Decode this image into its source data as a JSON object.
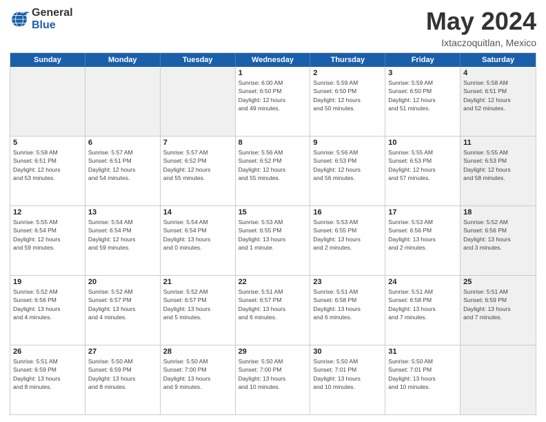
{
  "logo": {
    "general": "General",
    "blue": "Blue"
  },
  "title": "May 2024",
  "subtitle": "Ixtaczoquitlan, Mexico",
  "header_days": [
    "Sunday",
    "Monday",
    "Tuesday",
    "Wednesday",
    "Thursday",
    "Friday",
    "Saturday"
  ],
  "weeks": [
    [
      {
        "day": "",
        "info": "",
        "shaded": true
      },
      {
        "day": "",
        "info": "",
        "shaded": true
      },
      {
        "day": "",
        "info": "",
        "shaded": true
      },
      {
        "day": "1",
        "info": "Sunrise: 6:00 AM\nSunset: 6:50 PM\nDaylight: 12 hours\nand 49 minutes."
      },
      {
        "day": "2",
        "info": "Sunrise: 5:59 AM\nSunset: 6:50 PM\nDaylight: 12 hours\nand 50 minutes."
      },
      {
        "day": "3",
        "info": "Sunrise: 5:59 AM\nSunset: 6:50 PM\nDaylight: 12 hours\nand 51 minutes."
      },
      {
        "day": "4",
        "info": "Sunrise: 5:58 AM\nSunset: 6:51 PM\nDaylight: 12 hours\nand 52 minutes.",
        "shaded": true
      }
    ],
    [
      {
        "day": "5",
        "info": "Sunrise: 5:58 AM\nSunset: 6:51 PM\nDaylight: 12 hours\nand 53 minutes."
      },
      {
        "day": "6",
        "info": "Sunrise: 5:57 AM\nSunset: 6:51 PM\nDaylight: 12 hours\nand 54 minutes."
      },
      {
        "day": "7",
        "info": "Sunrise: 5:57 AM\nSunset: 6:52 PM\nDaylight: 12 hours\nand 55 minutes."
      },
      {
        "day": "8",
        "info": "Sunrise: 5:56 AM\nSunset: 6:52 PM\nDaylight: 12 hours\nand 55 minutes."
      },
      {
        "day": "9",
        "info": "Sunrise: 5:56 AM\nSunset: 6:53 PM\nDaylight: 12 hours\nand 56 minutes."
      },
      {
        "day": "10",
        "info": "Sunrise: 5:55 AM\nSunset: 6:53 PM\nDaylight: 12 hours\nand 57 minutes."
      },
      {
        "day": "11",
        "info": "Sunrise: 5:55 AM\nSunset: 6:53 PM\nDaylight: 12 hours\nand 58 minutes.",
        "shaded": true
      }
    ],
    [
      {
        "day": "12",
        "info": "Sunrise: 5:55 AM\nSunset: 6:54 PM\nDaylight: 12 hours\nand 59 minutes."
      },
      {
        "day": "13",
        "info": "Sunrise: 5:54 AM\nSunset: 6:54 PM\nDaylight: 12 hours\nand 59 minutes."
      },
      {
        "day": "14",
        "info": "Sunrise: 5:54 AM\nSunset: 6:54 PM\nDaylight: 13 hours\nand 0 minutes."
      },
      {
        "day": "15",
        "info": "Sunrise: 5:53 AM\nSunset: 6:55 PM\nDaylight: 13 hours\nand 1 minute."
      },
      {
        "day": "16",
        "info": "Sunrise: 5:53 AM\nSunset: 6:55 PM\nDaylight: 13 hours\nand 2 minutes."
      },
      {
        "day": "17",
        "info": "Sunrise: 5:53 AM\nSunset: 6:56 PM\nDaylight: 13 hours\nand 2 minutes."
      },
      {
        "day": "18",
        "info": "Sunrise: 5:52 AM\nSunset: 6:56 PM\nDaylight: 13 hours\nand 3 minutes.",
        "shaded": true
      }
    ],
    [
      {
        "day": "19",
        "info": "Sunrise: 5:52 AM\nSunset: 6:56 PM\nDaylight: 13 hours\nand 4 minutes."
      },
      {
        "day": "20",
        "info": "Sunrise: 5:52 AM\nSunset: 6:57 PM\nDaylight: 13 hours\nand 4 minutes."
      },
      {
        "day": "21",
        "info": "Sunrise: 5:52 AM\nSunset: 6:57 PM\nDaylight: 13 hours\nand 5 minutes."
      },
      {
        "day": "22",
        "info": "Sunrise: 5:51 AM\nSunset: 6:57 PM\nDaylight: 13 hours\nand 6 minutes."
      },
      {
        "day": "23",
        "info": "Sunrise: 5:51 AM\nSunset: 6:58 PM\nDaylight: 13 hours\nand 6 minutes."
      },
      {
        "day": "24",
        "info": "Sunrise: 5:51 AM\nSunset: 6:58 PM\nDaylight: 13 hours\nand 7 minutes."
      },
      {
        "day": "25",
        "info": "Sunrise: 5:51 AM\nSunset: 6:59 PM\nDaylight: 13 hours\nand 7 minutes.",
        "shaded": true
      }
    ],
    [
      {
        "day": "26",
        "info": "Sunrise: 5:51 AM\nSunset: 6:59 PM\nDaylight: 13 hours\nand 8 minutes."
      },
      {
        "day": "27",
        "info": "Sunrise: 5:50 AM\nSunset: 6:59 PM\nDaylight: 13 hours\nand 8 minutes."
      },
      {
        "day": "28",
        "info": "Sunrise: 5:50 AM\nSunset: 7:00 PM\nDaylight: 13 hours\nand 9 minutes."
      },
      {
        "day": "29",
        "info": "Sunrise: 5:50 AM\nSunset: 7:00 PM\nDaylight: 13 hours\nand 10 minutes."
      },
      {
        "day": "30",
        "info": "Sunrise: 5:50 AM\nSunset: 7:01 PM\nDaylight: 13 hours\nand 10 minutes."
      },
      {
        "day": "31",
        "info": "Sunrise: 5:50 AM\nSunset: 7:01 PM\nDaylight: 13 hours\nand 10 minutes."
      },
      {
        "day": "",
        "info": "",
        "shaded": true
      }
    ]
  ]
}
